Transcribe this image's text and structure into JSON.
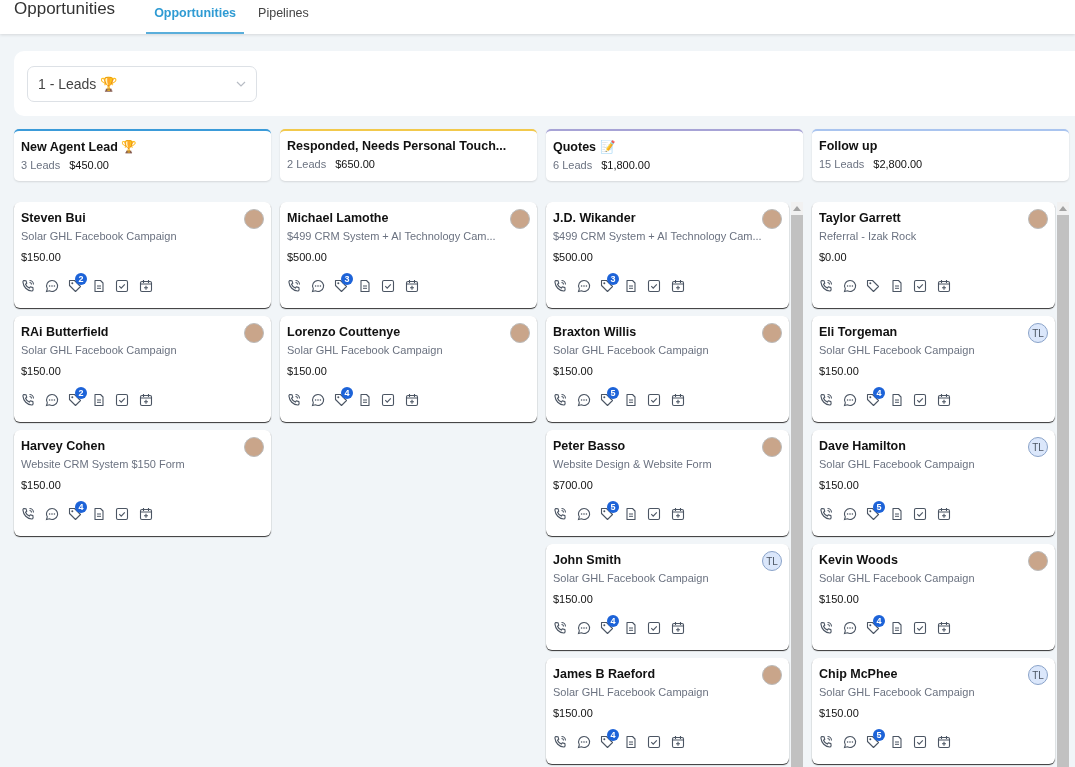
{
  "header": {
    "title": "Opportunities",
    "tabs": [
      {
        "label": "Opportunities",
        "selected": true
      },
      {
        "label": "Pipelines",
        "selected": false
      }
    ]
  },
  "filter": {
    "pipeline": "1 - Leads 🏆"
  },
  "columns": [
    {
      "title": "New Agent Lead 🏆",
      "count": "3 Leads",
      "total": "$450.00",
      "color": "#3b9bd9",
      "cards": [
        {
          "name": "Steven Bui",
          "source": "Solar GHL Facebook Campaign",
          "amount": "$150.00",
          "avatar": {
            "kind": "photo"
          },
          "tag_count": "2"
        },
        {
          "name": "RAi Butterfield",
          "source": "Solar GHL Facebook Campaign",
          "amount": "$150.00",
          "avatar": {
            "kind": "photo"
          },
          "tag_count": "2"
        },
        {
          "name": "Harvey Cohen",
          "source": "Website CRM System $150 Form",
          "amount": "$150.00",
          "avatar": {
            "kind": "photo"
          },
          "tag_count": "4"
        }
      ]
    },
    {
      "title": "Responded, Needs Personal Touch...",
      "count": "2 Leads",
      "total": "$650.00",
      "color": "#f2c94c",
      "cards": [
        {
          "name": "Michael Lamothe",
          "source": "$499 CRM System + AI Technology Cam...",
          "amount": "$500.00",
          "avatar": {
            "kind": "photo"
          },
          "tag_count": "3"
        },
        {
          "name": "Lorenzo Couttenye",
          "source": "Solar GHL Facebook Campaign",
          "amount": "$150.00",
          "avatar": {
            "kind": "photo"
          },
          "tag_count": "4"
        }
      ]
    },
    {
      "title": "Quotes 📝",
      "count": "6 Leads",
      "total": "$1,800.00",
      "color": "#a7a3d6",
      "cards": [
        {
          "name": "J.D. Wikander",
          "source": "$499 CRM System + AI Technology Cam...",
          "amount": "$500.00",
          "avatar": {
            "kind": "photo"
          },
          "tag_count": "3"
        },
        {
          "name": "Braxton Willis",
          "source": "Solar GHL Facebook Campaign",
          "amount": "$150.00",
          "avatar": {
            "kind": "photo"
          },
          "tag_count": "5"
        },
        {
          "name": "Peter Basso",
          "source": "Website Design & Website Form",
          "amount": "$700.00",
          "avatar": {
            "kind": "photo"
          },
          "tag_count": "5"
        },
        {
          "name": "John Smith",
          "source": "Solar GHL Facebook Campaign",
          "amount": "$150.00",
          "avatar": {
            "kind": "initials",
            "text": "TL"
          },
          "tag_count": "4"
        },
        {
          "name": "James B Raeford",
          "source": "Solar GHL Facebook Campaign",
          "amount": "$150.00",
          "avatar": {
            "kind": "photo"
          },
          "tag_count": "4"
        }
      ]
    },
    {
      "title": "Follow up",
      "count": "15 Leads",
      "total": "$2,800.00",
      "color": "#a9c4ef",
      "cards": [
        {
          "name": "Taylor Garrett",
          "source": "Referral - Izak Rock",
          "amount": "$0.00",
          "avatar": {
            "kind": "photo"
          }
        },
        {
          "name": "Eli Torgeman",
          "source": "Solar GHL Facebook Campaign",
          "amount": "$150.00",
          "avatar": {
            "kind": "initials",
            "text": "TL"
          },
          "tag_count": "4"
        },
        {
          "name": "Dave Hamilton",
          "source": "Solar GHL Facebook Campaign",
          "amount": "$150.00",
          "avatar": {
            "kind": "initials",
            "text": "TL"
          },
          "tag_count": "5"
        },
        {
          "name": "Kevin Woods",
          "source": "Solar GHL Facebook Campaign",
          "amount": "$150.00",
          "avatar": {
            "kind": "photo"
          },
          "tag_count": "4"
        },
        {
          "name": "Chip McPhee",
          "source": "Solar GHL Facebook Campaign",
          "amount": "$150.00",
          "avatar": {
            "kind": "initials",
            "text": "TL"
          },
          "tag_count": "5"
        }
      ]
    }
  ]
}
